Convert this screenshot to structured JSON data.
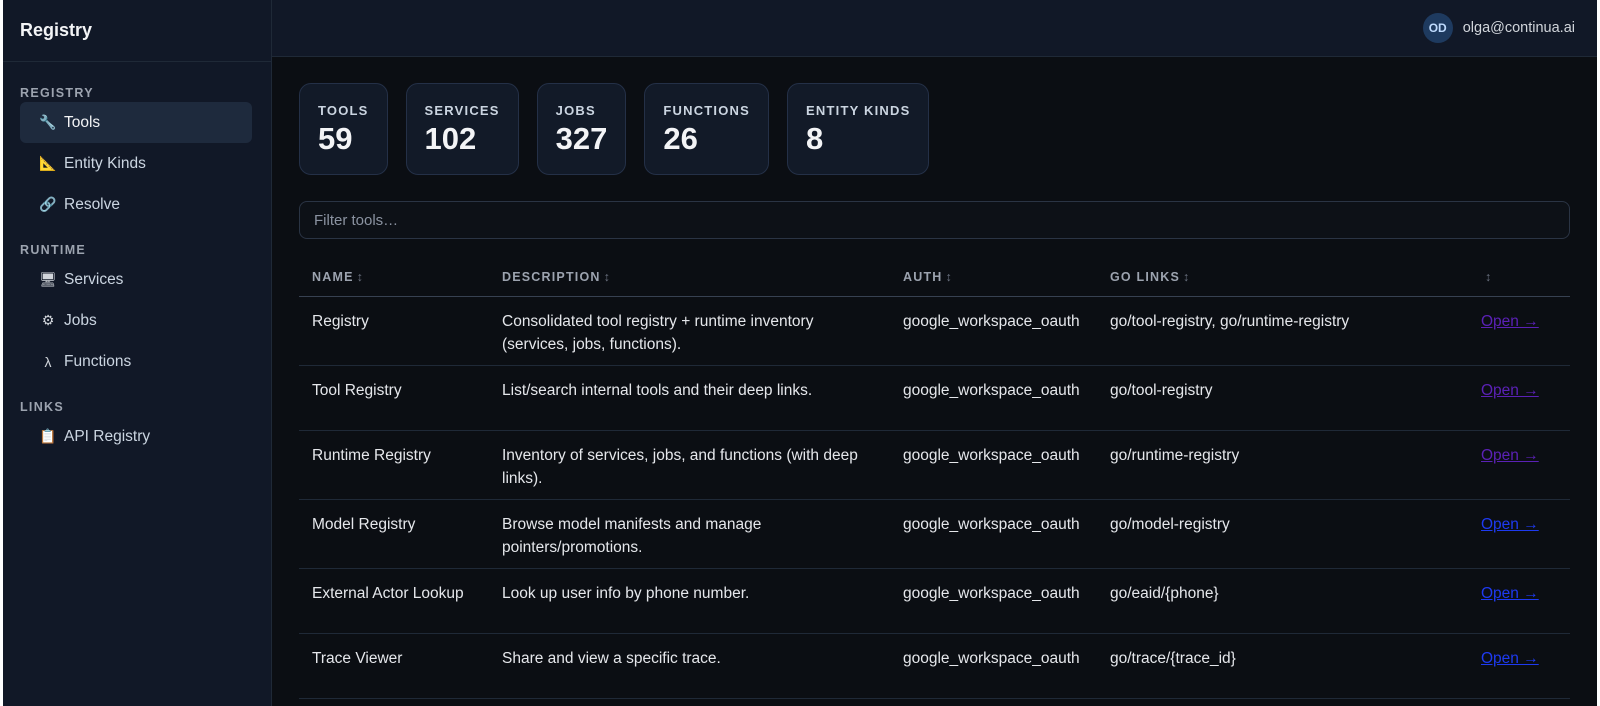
{
  "sidebar": {
    "title": "Registry",
    "sections": [
      {
        "heading": "REGISTRY",
        "items": [
          {
            "label": "Tools",
            "icon": "🔧",
            "active": true
          },
          {
            "label": "Entity Kinds",
            "icon": "📐"
          },
          {
            "label": "Resolve",
            "icon": "🔗"
          }
        ]
      },
      {
        "heading": "RUNTIME",
        "items": [
          {
            "label": "Services",
            "icon": "🖥"
          },
          {
            "label": "Jobs",
            "icon": "⚙"
          },
          {
            "label": "Functions",
            "icon": "λ"
          }
        ]
      },
      {
        "heading": "LINKS",
        "items": [
          {
            "label": "API Registry",
            "icon": "📋"
          }
        ]
      }
    ]
  },
  "header": {
    "avatar_initials": "OD",
    "user_email": "olga@continua.ai"
  },
  "stats": [
    {
      "label": "TOOLS",
      "value": "59"
    },
    {
      "label": "SERVICES",
      "value": "102"
    },
    {
      "label": "JOBS",
      "value": "327"
    },
    {
      "label": "FUNCTIONS",
      "value": "26"
    },
    {
      "label": "ENTITY KINDS",
      "value": "8"
    }
  ],
  "filter": {
    "placeholder": "Filter tools…",
    "value": ""
  },
  "table": {
    "columns": [
      "NAME",
      "DESCRIPTION",
      "AUTH",
      "GO LINKS",
      ""
    ],
    "sort_icon": "↕",
    "open_label": "Open →",
    "rows": [
      {
        "name": "Registry",
        "description": "Consolidated tool registry + runtime inventory (services, jobs, functions).",
        "auth": "google_workspace_oauth",
        "go_links": "go/tool-registry, go/runtime-registry",
        "visited": true
      },
      {
        "name": "Tool Registry",
        "description": "List/search internal tools and their deep links.",
        "auth": "google_workspace_oauth",
        "go_links": "go/tool-registry",
        "visited": true
      },
      {
        "name": "Runtime Registry",
        "description": "Inventory of services, jobs, and functions (with deep links).",
        "auth": "google_workspace_oauth",
        "go_links": "go/runtime-registry",
        "visited": true
      },
      {
        "name": "Model Registry",
        "description": "Browse model manifests and manage pointers/promotions.",
        "auth": "google_workspace_oauth",
        "go_links": "go/model-registry",
        "visited": false
      },
      {
        "name": "External Actor Lookup",
        "description": "Look up user info by phone number.",
        "auth": "google_workspace_oauth",
        "go_links": "go/eaid/{phone}",
        "visited": false
      },
      {
        "name": "Trace Viewer",
        "description": "Share and view a specific trace.",
        "auth": "google_workspace_oauth",
        "go_links": "go/trace/{trace_id}",
        "visited": false
      }
    ]
  },
  "colors": {
    "background": "#0b0e13",
    "sidebar": "#111827",
    "active_nav": "#1e2a3d",
    "link": "#1e3af0",
    "link_visited": "#5b21b6"
  }
}
